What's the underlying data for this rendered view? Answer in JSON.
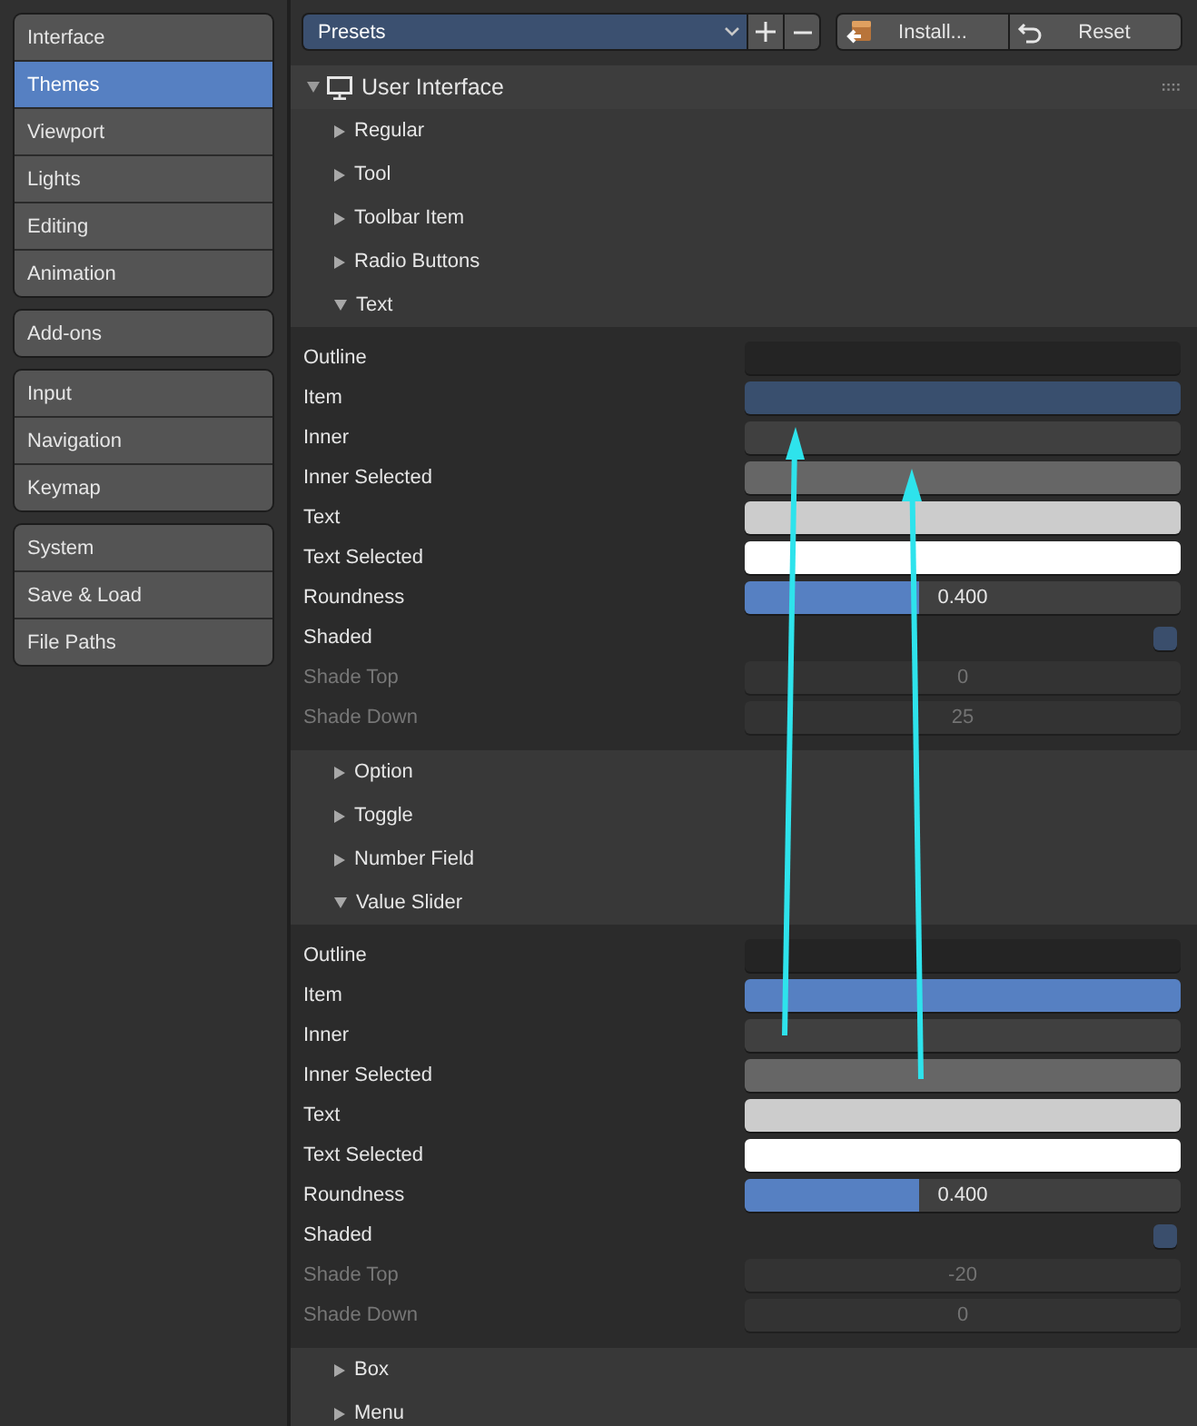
{
  "sidebar": {
    "groups": [
      {
        "items": [
          {
            "label": "Interface",
            "selected": false
          },
          {
            "label": "Themes",
            "selected": true
          },
          {
            "label": "Viewport",
            "selected": false
          },
          {
            "label": "Lights",
            "selected": false
          },
          {
            "label": "Editing",
            "selected": false
          },
          {
            "label": "Animation",
            "selected": false
          }
        ]
      },
      {
        "items": [
          {
            "label": "Add-ons",
            "selected": false
          }
        ]
      },
      {
        "items": [
          {
            "label": "Input",
            "selected": false
          },
          {
            "label": "Navigation",
            "selected": false
          },
          {
            "label": "Keymap",
            "selected": false
          }
        ]
      },
      {
        "items": [
          {
            "label": "System",
            "selected": false
          },
          {
            "label": "Save & Load",
            "selected": false
          },
          {
            "label": "File Paths",
            "selected": false
          }
        ]
      }
    ]
  },
  "toolbar": {
    "presets": "Presets",
    "install": "Install...",
    "reset": "Reset"
  },
  "panel": {
    "title": "User Interface",
    "expanded": true,
    "sections": [
      {
        "label": "Regular",
        "expanded": false
      },
      {
        "label": "Tool",
        "expanded": false
      },
      {
        "label": "Toolbar Item",
        "expanded": false
      },
      {
        "label": "Radio Buttons",
        "expanded": false
      },
      {
        "label": "Text",
        "expanded": true,
        "properties": [
          {
            "label": "Outline",
            "kind": "color",
            "color": "#242424",
            "disabled": false
          },
          {
            "label": "Item",
            "kind": "color",
            "color": "#394f6e",
            "disabled": false
          },
          {
            "label": "Inner",
            "kind": "color",
            "color": "#404040",
            "disabled": false
          },
          {
            "label": "Inner Selected",
            "kind": "color",
            "color": "#666666",
            "disabled": false
          },
          {
            "label": "Text",
            "kind": "color",
            "color": "#cccccc",
            "disabled": false
          },
          {
            "label": "Text Selected",
            "kind": "color",
            "color": "#ffffff",
            "disabled": false
          },
          {
            "label": "Roundness",
            "kind": "slider",
            "level": 0.4,
            "reading": "0.400",
            "disabled": false
          },
          {
            "label": "Shaded",
            "kind": "checkbox",
            "checked": false,
            "disabled": false
          },
          {
            "label": "Shade Top",
            "kind": "number",
            "value": "0",
            "disabled": true
          },
          {
            "label": "Shade Down",
            "kind": "number",
            "value": "25",
            "disabled": true
          }
        ]
      },
      {
        "label": "Option",
        "expanded": false
      },
      {
        "label": "Toggle",
        "expanded": false
      },
      {
        "label": "Number Field",
        "expanded": false
      },
      {
        "label": "Value Slider",
        "expanded": true,
        "properties": [
          {
            "label": "Outline",
            "kind": "color",
            "color": "#242424",
            "disabled": false
          },
          {
            "label": "Item",
            "kind": "color",
            "color": "#5680c2",
            "disabled": false
          },
          {
            "label": "Inner",
            "kind": "color",
            "color": "#404040",
            "disabled": false
          },
          {
            "label": "Inner Selected",
            "kind": "color",
            "color": "#666666",
            "disabled": false
          },
          {
            "label": "Text",
            "kind": "color",
            "color": "#cccccc",
            "disabled": false
          },
          {
            "label": "Text Selected",
            "kind": "color",
            "color": "#ffffff",
            "disabled": false
          },
          {
            "label": "Roundness",
            "kind": "slider",
            "level": 0.4,
            "reading": "0.400",
            "disabled": false
          },
          {
            "label": "Shaded",
            "kind": "checkbox",
            "checked": false,
            "disabled": false
          },
          {
            "label": "Shade Top",
            "kind": "number",
            "value": "-20",
            "disabled": true
          },
          {
            "label": "Shade Down",
            "kind": "number",
            "value": "0",
            "disabled": true
          }
        ]
      },
      {
        "label": "Box",
        "expanded": false
      },
      {
        "label": "Menu",
        "expanded": false
      }
    ]
  }
}
